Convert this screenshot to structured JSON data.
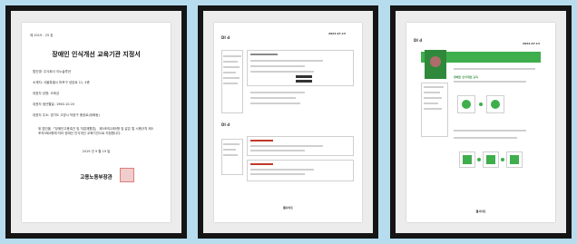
{
  "certificate": {
    "number": "제 2019 - 25 호",
    "title": "장애인 인식개선 교육기관 지정서",
    "fields": [
      "법인명: 주식회사 이노솔루션",
      "소재지: 서울특별시 마포구 성암로 11, 4층",
      "대표자 성명: 오희균",
      "대표자 생년월일: 1960.10.20",
      "대표자 주소: 경기도 고양시 덕양구 충장로(대화동)"
    ],
    "body_text": "위 법인을 「장애인고용촉진 및 직업재활법」 제5조의2제5항 및 같은 법 시행규칙 제5조의5제4항에 따라 장애인 인식개선 교육기관으로 지정합니다.",
    "date": "2019 년 9 월 19 일",
    "issuer": "고용노동부장관"
  },
  "doc2": {
    "logo": "DI d",
    "top_date": "2022.07.13",
    "section_logo": "DI d",
    "footer": "웹사이트"
  },
  "doc3": {
    "logo": "DI d",
    "top_date": "2022.07.13",
    "section_heading": "장애인 인식개선 교육",
    "footer": "웹사이트"
  }
}
